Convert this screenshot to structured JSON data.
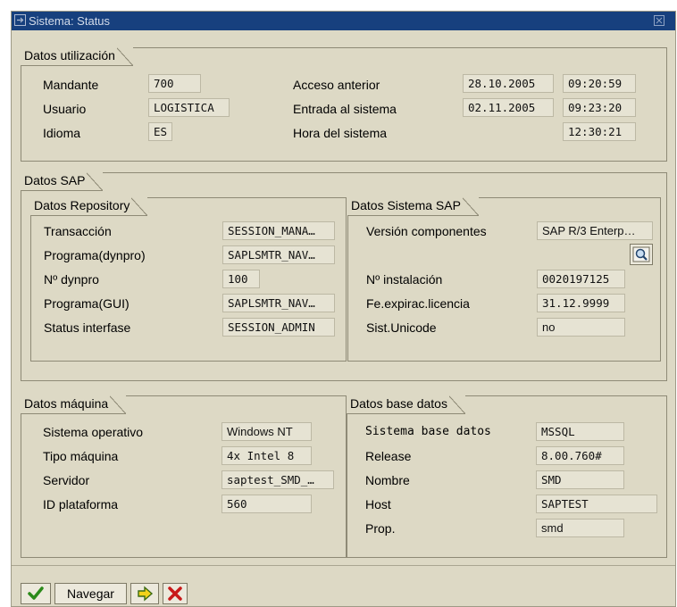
{
  "window": {
    "title": "Sistema: Status"
  },
  "utilizacion": {
    "tab": "Datos utilización",
    "mandante_label": "Mandante",
    "mandante": "700",
    "usuario_label": "Usuario",
    "usuario": "LOGISTICA",
    "idioma_label": "Idioma",
    "idioma": "ES",
    "acceso_label": "Acceso anterior",
    "acceso_fecha": "28.10.2005",
    "acceso_hora": "09:20:59",
    "entrada_label": "Entrada al sistema",
    "entrada_fecha": "02.11.2005",
    "entrada_hora": "09:23:20",
    "hora_label": "Hora del sistema",
    "hora": "12:30:21"
  },
  "sap": {
    "tab": "Datos SAP",
    "repository": {
      "tab": "Datos Repository",
      "transaccion_label": "Transacción",
      "transaccion": "SESSION_MANA…",
      "programa_dynpro_label": "Programa(dynpro)",
      "programa_dynpro": "SAPLSMTR_NAV…",
      "dynpro_label": "Nº dynpro",
      "dynpro": "100",
      "programa_gui_label": "Programa(GUI)",
      "programa_gui": "SAPLSMTR_NAV…",
      "status_label": "Status interfase",
      "status": "SESSION_ADMIN"
    },
    "sistema": {
      "tab": "Datos Sistema SAP",
      "version_label": "Versión componentes",
      "version": "SAP R/3 Enterp…",
      "instalacion_label": "Nº instalación",
      "instalacion": "0020197125",
      "licencia_label": "Fe.expirac.licencia",
      "licencia": "31.12.9999",
      "unicode_label": "Sist.Unicode",
      "unicode": "no"
    }
  },
  "maquina": {
    "tab": "Datos máquina",
    "so_label": "Sistema operativo",
    "so": "Windows NT",
    "tipo_label": "Tipo máquina",
    "tipo": "4x Intel 8",
    "servidor_label": "Servidor",
    "servidor": "saptest_SMD_…",
    "plataforma_label": "ID plataforma",
    "plataforma": "560"
  },
  "basedatos": {
    "tab": "Datos base datos",
    "sistema_label": "Sistema base datos",
    "sistema": "MSSQL",
    "release_label": "Release",
    "release": "8.00.760#",
    "nombre_label": "Nombre",
    "nombre": "SMD",
    "host_label": "Host",
    "host": "SAPTEST",
    "prop_label": "Prop.",
    "prop": "smd"
  },
  "toolbar": {
    "navegar": "Navegar"
  }
}
